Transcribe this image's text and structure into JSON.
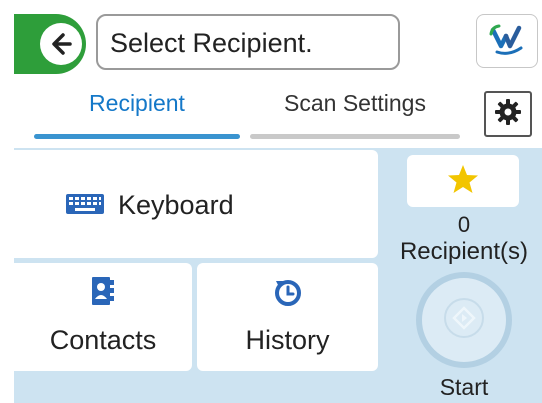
{
  "header": {
    "message": "Select Recipient.",
    "back_icon": "back-arrow-icon",
    "help_icon": "epson-connect-icon"
  },
  "tabs": [
    {
      "label": "Recipient",
      "active": true
    },
    {
      "label": "Scan Settings",
      "active": false
    }
  ],
  "settings_icon": "gear-icon",
  "main": {
    "keyboard_label": "Keyboard",
    "contacts_label": "Contacts",
    "history_label": "History",
    "recipient_count": "0",
    "recipient_label": "Recipient(s)",
    "start_label": "Start"
  },
  "colors": {
    "accent": "#1478c8",
    "back_button": "#2e9e3a",
    "main_background": "#cde3f1",
    "star": "#f2c500"
  }
}
